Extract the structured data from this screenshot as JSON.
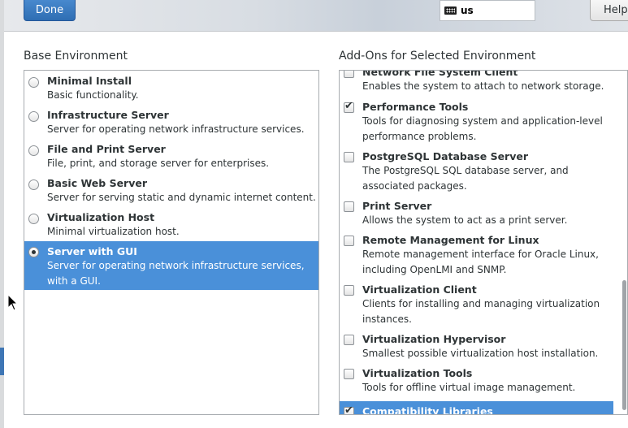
{
  "header": {
    "done_label": "Done",
    "keyboard_layout": "us",
    "help_label": "Help!"
  },
  "base_environment": {
    "heading": "Base Environment",
    "items": [
      {
        "title": "Minimal Install",
        "desc": "Basic functionality.",
        "selected": false
      },
      {
        "title": "Infrastructure Server",
        "desc": "Server for operating network infrastructure services.",
        "selected": false
      },
      {
        "title": "File and Print Server",
        "desc": "File, print, and storage server for enterprises.",
        "selected": false
      },
      {
        "title": "Basic Web Server",
        "desc": "Server for serving static and dynamic internet content.",
        "selected": false
      },
      {
        "title": "Virtualization Host",
        "desc": "Minimal virtualization host.",
        "selected": false
      },
      {
        "title": "Server with GUI",
        "desc": "Server for operating network infrastructure services, with a GUI.",
        "selected": true
      }
    ]
  },
  "addons": {
    "heading": "Add-Ons for Selected Environment",
    "items": [
      {
        "title": "Network File System Client",
        "desc": "Enables the system to attach to network storage.",
        "checked": false
      },
      {
        "title": "Performance Tools",
        "desc": "Tools for diagnosing system and application-level performance problems.",
        "checked": true
      },
      {
        "title": "PostgreSQL Database Server",
        "desc": "The PostgreSQL SQL database server, and associated packages.",
        "checked": false
      },
      {
        "title": "Print Server",
        "desc": "Allows the system to act as a print server.",
        "checked": false
      },
      {
        "title": "Remote Management for Linux",
        "desc": "Remote management interface for Oracle Linux, including OpenLMI and SNMP.",
        "checked": false
      },
      {
        "title": "Virtualization Client",
        "desc": "Clients for installing and managing virtualization instances.",
        "checked": false
      },
      {
        "title": "Virtualization Hypervisor",
        "desc": "Smallest possible virtualization host installation.",
        "checked": false
      },
      {
        "title": "Virtualization Tools",
        "desc": "Tools for offline virtual image management.",
        "checked": false
      },
      {
        "title": "Compatibility Libraries",
        "desc": "",
        "checked": true
      }
    ]
  },
  "colors": {
    "selection": "#4a90d9",
    "done_button": "#3a7bc8"
  }
}
